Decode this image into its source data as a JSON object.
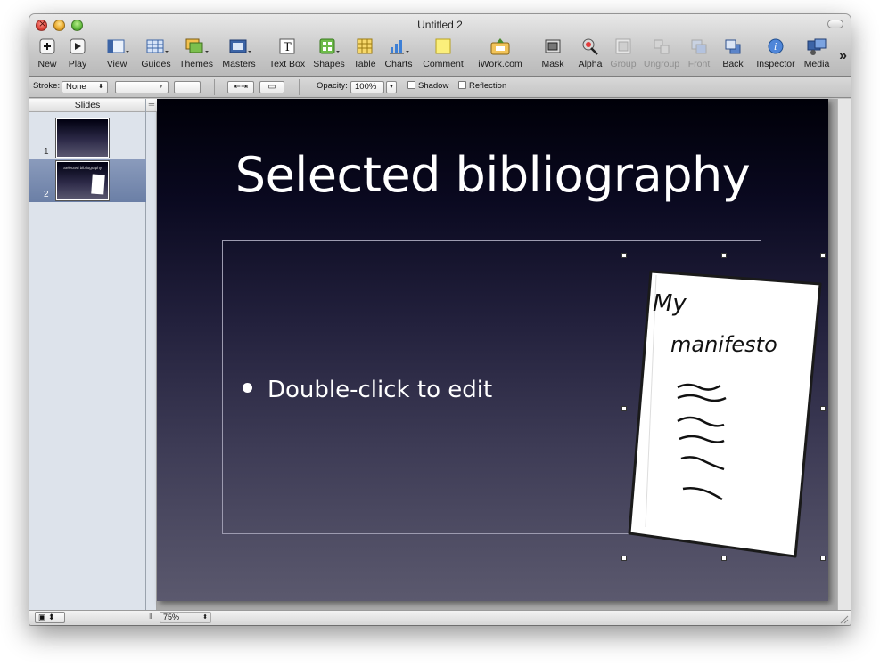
{
  "window": {
    "title": "Untitled 2"
  },
  "toolbar": {
    "items": [
      {
        "label": "New",
        "icon": "plus-icon",
        "enabled": true
      },
      {
        "label": "Play",
        "icon": "play-icon",
        "enabled": true
      },
      {
        "label": "View",
        "icon": "view-icon",
        "enabled": true
      },
      {
        "label": "Guides",
        "icon": "grid-icon",
        "enabled": true
      },
      {
        "label": "Themes",
        "icon": "themes-icon",
        "enabled": true
      },
      {
        "label": "Masters",
        "icon": "masters-icon",
        "enabled": true
      },
      {
        "label": "Text Box",
        "icon": "text-box-icon",
        "enabled": true
      },
      {
        "label": "Shapes",
        "icon": "shapes-icon",
        "enabled": true
      },
      {
        "label": "Table",
        "icon": "table-icon",
        "enabled": true
      },
      {
        "label": "Charts",
        "icon": "chart-icon",
        "enabled": true
      },
      {
        "label": "Comment",
        "icon": "comment-icon",
        "enabled": true
      },
      {
        "label": "iWork.com",
        "icon": "iwork-share-icon",
        "enabled": true
      },
      {
        "label": "Mask",
        "icon": "mask-icon",
        "enabled": true
      },
      {
        "label": "Alpha",
        "icon": "alpha-wand-icon",
        "enabled": true
      },
      {
        "label": "Group",
        "icon": "group-icon",
        "enabled": false
      },
      {
        "label": "Ungroup",
        "icon": "ungroup-icon",
        "enabled": false
      },
      {
        "label": "Front",
        "icon": "front-icon",
        "enabled": false
      },
      {
        "label": "Back",
        "icon": "back-icon",
        "enabled": true
      },
      {
        "label": "Inspector",
        "icon": "info-icon",
        "enabled": true
      },
      {
        "label": "Media",
        "icon": "media-icon",
        "enabled": true
      }
    ],
    "overflow": "»"
  },
  "format_bar": {
    "stroke_label": "Stroke:",
    "stroke_value": "None",
    "opacity_label": "Opacity:",
    "opacity_value": "100%",
    "shadow_label": "Shadow",
    "reflection_label": "Reflection"
  },
  "navigator": {
    "header": "Slides",
    "slides": [
      {
        "number": "1",
        "title": ""
      },
      {
        "number": "2",
        "title": "Selected bibliography"
      }
    ],
    "selected": 2
  },
  "slide": {
    "title": "Selected bibliography",
    "bullet": "Double-click to edit",
    "image_text_line1": "My",
    "image_text_line2": "manifesto"
  },
  "bottom_bar": {
    "zoom": "75%"
  },
  "colors": {
    "slide_top": "#000008",
    "slide_bottom": "#5b596e",
    "selection": "#7386ab"
  }
}
